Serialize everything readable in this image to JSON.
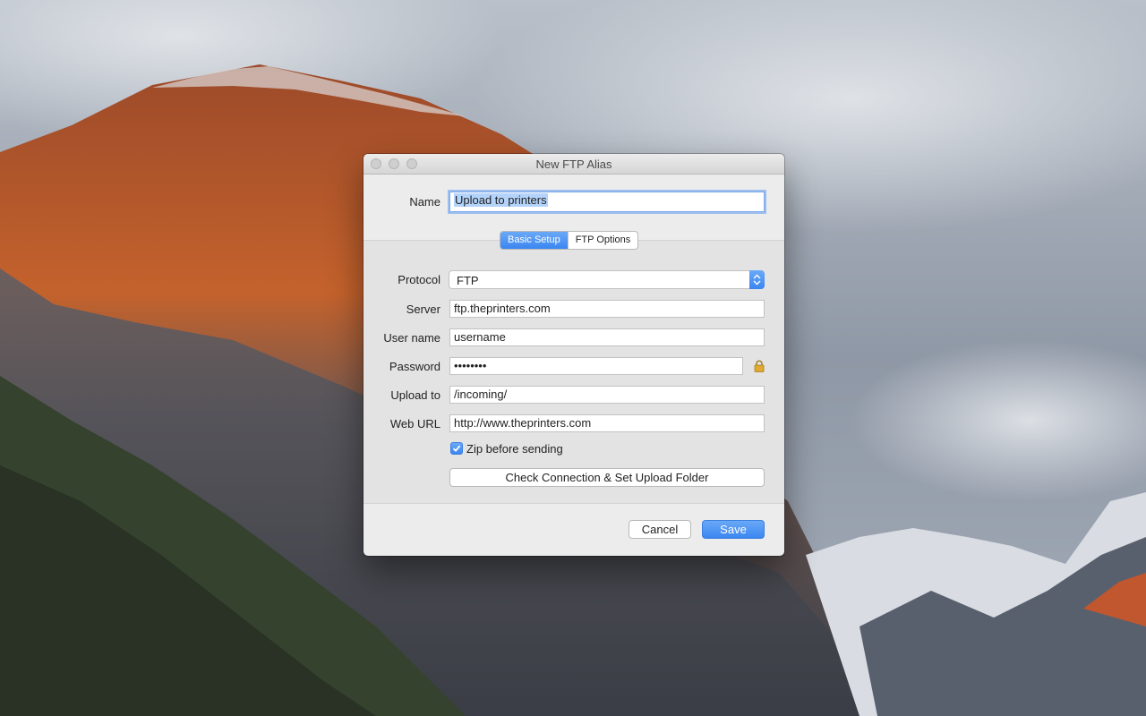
{
  "window": {
    "title": "New FTP Alias"
  },
  "name": {
    "label": "Name",
    "value": "Upload to printers"
  },
  "tabs": [
    {
      "label": "Basic Setup",
      "active": true
    },
    {
      "label": "FTP Options",
      "active": false
    }
  ],
  "protocol": {
    "label": "Protocol",
    "value": "FTP"
  },
  "server": {
    "label": "Server",
    "value": "ftp.theprinters.com"
  },
  "username": {
    "label": "User name",
    "value": "username"
  },
  "password": {
    "label": "Password",
    "value": "••••••••"
  },
  "upload_to": {
    "label": "Upload to",
    "value": "/incoming/"
  },
  "web_url": {
    "label": "Web URL",
    "value": "http://www.theprinters.com"
  },
  "zip": {
    "label": "Zip before sending",
    "checked": true
  },
  "buttons": {
    "check": "Check Connection & Set Upload Folder",
    "cancel": "Cancel",
    "save": "Save"
  },
  "colors": {
    "accent": "#3a86f0",
    "window_bg": "#ececec"
  },
  "icons": [
    "lock-icon",
    "chevron-updown-icon",
    "checkmark-icon"
  ]
}
